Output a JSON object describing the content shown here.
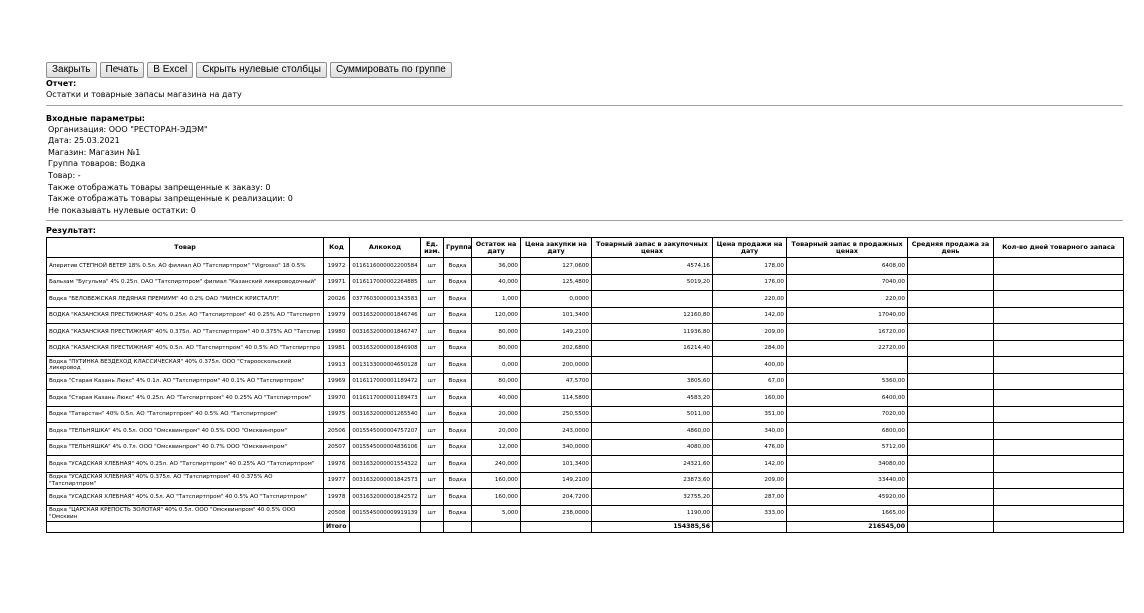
{
  "toolbar": {
    "close_label": "Закрыть",
    "print_label": "Печать",
    "excel_label": "В Excel",
    "hide_zero_label": "Скрыть нулевые столбцы",
    "sum_group_label": "Суммировать по группе"
  },
  "report": {
    "heading": "Отчет:",
    "name": "Остатки и товарные запасы магазина на дату"
  },
  "params": {
    "heading": "Входные параметры:",
    "lines": [
      "Организация: ООО \"РЕСТОРАН-ЭДЭМ\"",
      "Дата: 25.03.2021",
      "Магазин: Магазин №1",
      "Группа товаров: Водка",
      "Товар: -",
      "Также отображать товары запрещенные к заказу: 0",
      "Также отображать товары запрещенные к реализации: 0",
      "Не показывать нулевые остатки: 0"
    ]
  },
  "result": {
    "heading": "Результат:",
    "columns": [
      "Товар",
      "Код",
      "Алкокод",
      "Ед. изм.",
      "Группа",
      "Остаток на дату",
      "Цена закупки на дату",
      "Товарный запас в закупочных ценах",
      "Цена продажи на дату",
      "Товарный запас в продажных ценах",
      "Средняя продажа за день",
      "Кол-во дней товарного запаса"
    ],
    "rows": [
      [
        "Аперитив СТЕПНОЙ ВЕТЕР 18% 0.5л. АО филиал АО \"Татспиртпром\" \"Vigrosso\" 18 0.5%",
        "19972",
        "0116116000002200584",
        "шт",
        "Водка",
        "36,000",
        "127,0600",
        "4574,16",
        "178,00",
        "6408,00",
        "",
        ""
      ],
      [
        "Бальзам \"Бугульма\" 4% 0.25л. ОАО \"Татспиртпром\" филиал \"Казанский ликероводочный\"",
        "19971",
        "0116117000002264885",
        "шт",
        "Водка",
        "40,000",
        "125,4800",
        "5019,20",
        "176,00",
        "7040,00",
        "",
        ""
      ],
      [
        "Водка \"БЕЛОВЕЖСКАЯ ЛЕДЯНАЯ ПРЕМИУМ\" 40 0.2% ОАО \"МИНСК КРИСТАЛЛ\"",
        "20026",
        "0377603000001343583",
        "шт",
        "Водка",
        "1,000",
        "0,0000",
        "",
        "220,00",
        "220,00",
        "",
        ""
      ],
      [
        "ВОДКА \"КАЗАНСКАЯ ПРЕСТИЖНАЯ\" 40% 0.25л. АО \"Татспиртпром\" 40 0.25% АО \"Татспиртп",
        "19979",
        "0031632000001846746",
        "шт",
        "Водка",
        "120,000",
        "101,3400",
        "12160,80",
        "142,00",
        "17040,00",
        "",
        ""
      ],
      [
        "ВОДКА \"КАЗАНСКАЯ ПРЕСТИЖНАЯ\" 40% 0.375л. АО \"Татспиртпром\" 40 0.375% АО \"Татспир",
        "19980",
        "0031632000001846747",
        "шт",
        "Водка",
        "80,000",
        "149,2100",
        "11936,80",
        "209,00",
        "16720,00",
        "",
        ""
      ],
      [
        "ВОДКА \"КАЗАНСКАЯ ПРЕСТИЖНАЯ\" 40% 0.5л. АО \"Татспиртпром\" 40 0.5% АО \"Татспиртпро",
        "19981",
        "0031632000001846908",
        "шт",
        "Водка",
        "80,000",
        "202,6800",
        "16214,40",
        "284,00",
        "22720,00",
        "",
        ""
      ],
      [
        "Водка \"ПУТИНКА ВЕЗДЕХОД КЛАССИЧЕСКАЯ\" 40% 0.375л. ООО \"Старооскольский ликеровод",
        "19913",
        "0013133000004650128",
        "шт",
        "Водка",
        "0,000",
        "200,0000",
        "",
        "400,00",
        "",
        "",
        ""
      ],
      [
        "Водка \"Старая Казань Люкс\" 4% 0.1л. АО \"Татспиртпром\" 40 0.1% АО \"Татспиртпром\"",
        "19969",
        "0116117000001189472",
        "шт",
        "Водка",
        "80,000",
        "47,5700",
        "3805,60",
        "67,00",
        "5360,00",
        "",
        ""
      ],
      [
        "Водка \"Старая Казань Люкс\" 4% 0.25л. АО \"Татспиртпром\" 40 0.25% АО \"Татспиртпром\"",
        "19970",
        "0116117000001189473",
        "шт",
        "Водка",
        "40,000",
        "114,5800",
        "4583,20",
        "160,00",
        "6400,00",
        "",
        ""
      ],
      [
        "Водка \"Татарстан\" 40% 0.5л. АО \"Татспиртпром\" 40 0.5% АО \"Татспиртпром\"",
        "19975",
        "0031632000001265540",
        "шт",
        "Водка",
        "20,000",
        "250,5500",
        "5011,00",
        "351,00",
        "7020,00",
        "",
        ""
      ],
      [
        "Водка \"ТЕЛЬНЯШКА\" 4% 0.5л. ООО \"Омсквинпром\" 40 0.5% ООО \"Омсквинпром\"",
        "20506",
        "0015545000004757207",
        "шт",
        "Водка",
        "20,000",
        "243,0000",
        "4860,00",
        "340,00",
        "6800,00",
        "",
        ""
      ],
      [
        "Водка \"ТЕЛЬНЯШКА\" 4% 0.7л. ООО \"Омсквинпром\" 40 0.7% ООО \"Омсквинпром\"",
        "20507",
        "0015545000004836106",
        "шт",
        "Водка",
        "12,000",
        "340,0000",
        "4080,00",
        "476,00",
        "5712,00",
        "",
        ""
      ],
      [
        "Водка \"УСАДСКАЯ ХЛЕБНАЯ\" 40% 0.25л. АО \"Татспиртпром\" 40 0.25% АО \"Татспиртпром\"",
        "19976",
        "0031632000001554322",
        "шт",
        "Водка",
        "240,000",
        "101,3400",
        "24321,60",
        "142,00",
        "34080,00",
        "",
        ""
      ],
      [
        "Водка \"УСАДСКАЯ ХЛЕБНАЯ\" 40% 0.375л. АО \"Татспиртпром\" 40 0.375% АО \"Татспиртпром\"",
        "19977",
        "0031632000001842573",
        "шт",
        "Водка",
        "160,000",
        "149,2100",
        "23873,60",
        "209,00",
        "33440,00",
        "",
        ""
      ],
      [
        "Водка \"УСАДСКАЯ ХЛЕБНАЯ\" 40% 0.5л. АО \"Татспиртпром\" 40 0.5% АО \"Татспиртпром\"",
        "19978",
        "0031632000001842572",
        "шт",
        "Водка",
        "160,000",
        "204,7200",
        "32755,20",
        "287,00",
        "45920,00",
        "",
        ""
      ],
      [
        "Водка \"ЦАРСКАЯ КРЕПОСТЬ ЗОЛОТАЯ\" 40% 0.5л. ООО \"Омсквинпром\" 40 0.5% ООО \"Омсквин",
        "20508",
        "0015545000009919139",
        "шт",
        "Водка",
        "5,000",
        "238,0000",
        "1190,00",
        "333,00",
        "1665,00",
        "",
        ""
      ]
    ],
    "total": {
      "label": "Итого",
      "purchase_stock": "154385,56",
      "sale_stock": "216545,00"
    }
  }
}
